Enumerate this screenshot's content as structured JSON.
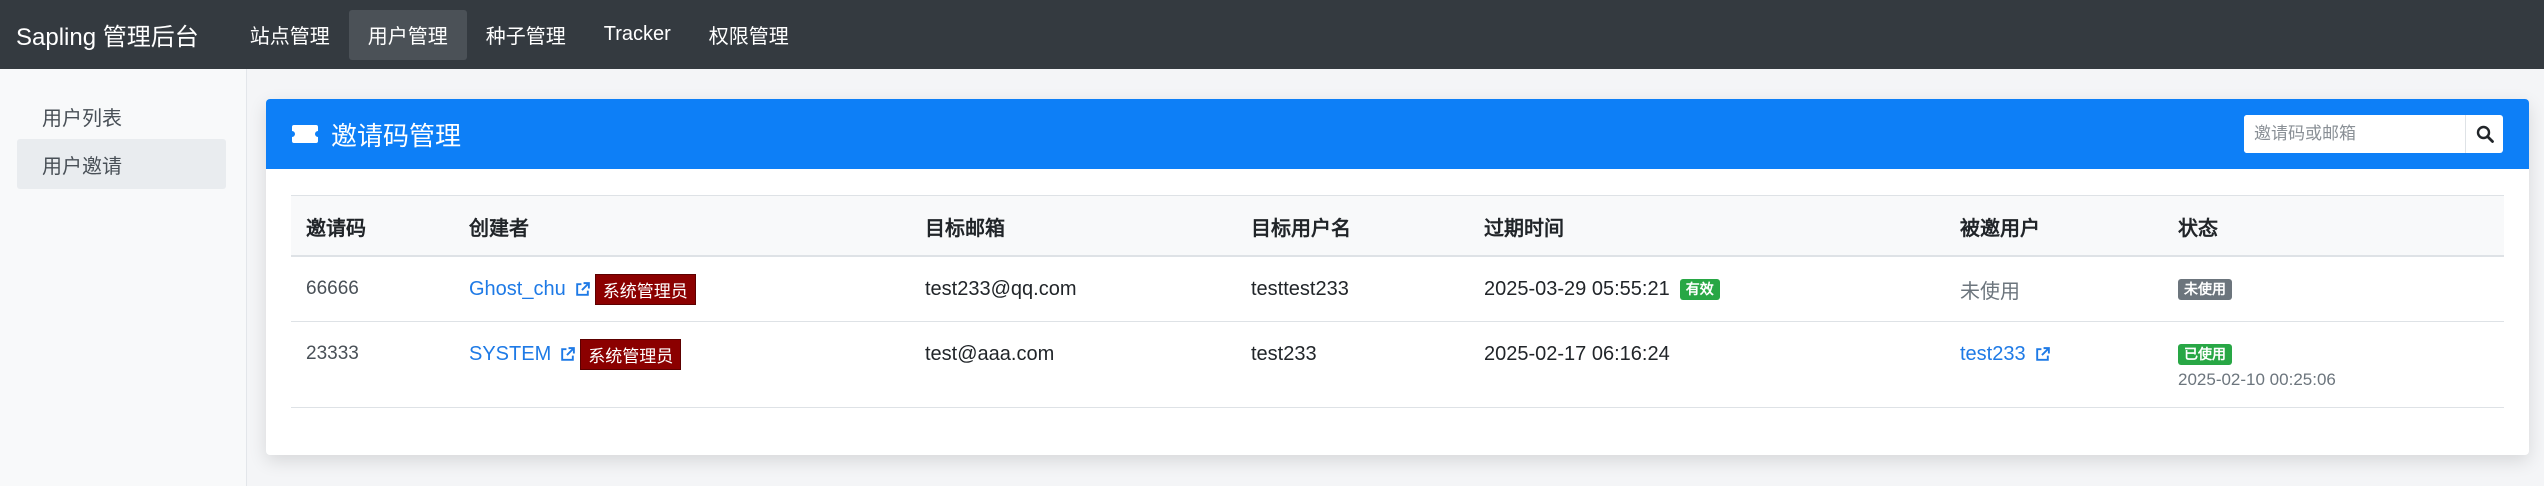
{
  "app": {
    "brand": "Sapling 管理后台",
    "nav": [
      {
        "label": "站点管理"
      },
      {
        "label": "用户管理"
      },
      {
        "label": "种子管理"
      },
      {
        "label": "Tracker"
      },
      {
        "label": "权限管理"
      }
    ],
    "active_nav": "用户管理"
  },
  "sidebar": {
    "items": [
      {
        "label": "用户列表"
      },
      {
        "label": "用户邀请"
      }
    ],
    "active_item": "用户邀请"
  },
  "card": {
    "title": "邀请码管理",
    "icon": "ticket-icon",
    "search": {
      "placeholder": "邀请码或邮箱",
      "value": "",
      "icon": "search-icon"
    }
  },
  "table": {
    "headers": [
      "邀请码",
      "创建者",
      "目标邮箱",
      "目标用户名",
      "过期时间",
      "被邀用户",
      "状态"
    ],
    "rows": [
      {
        "code": "66666",
        "creator": "Ghost_chu",
        "creator_role": "系统管理员",
        "email": "test233@qq.com",
        "username": "testtest233",
        "expire": "2025-03-29 05:55:21",
        "expire_badge": "有效",
        "invitee": "未使用",
        "status": "未使用",
        "used_time": ""
      },
      {
        "code": "23333",
        "creator": "SYSTEM",
        "creator_role": "系统管理员",
        "email": "test@aaa.com",
        "username": "test233",
        "expire": "2025-02-17 06:16:24",
        "expire_badge": "",
        "invitee": "test233",
        "status": "已使用",
        "used_time": "2025-02-10 00:25:06"
      }
    ]
  },
  "colors": {
    "navbar": "#343a40",
    "header_accent": "#0d7ff7",
    "link": "#1e7ae6",
    "role_badge": "#8b0000",
    "valid_badge": "#28a745",
    "unused_badge": "#6c757d",
    "used_badge": "#28a745"
  }
}
